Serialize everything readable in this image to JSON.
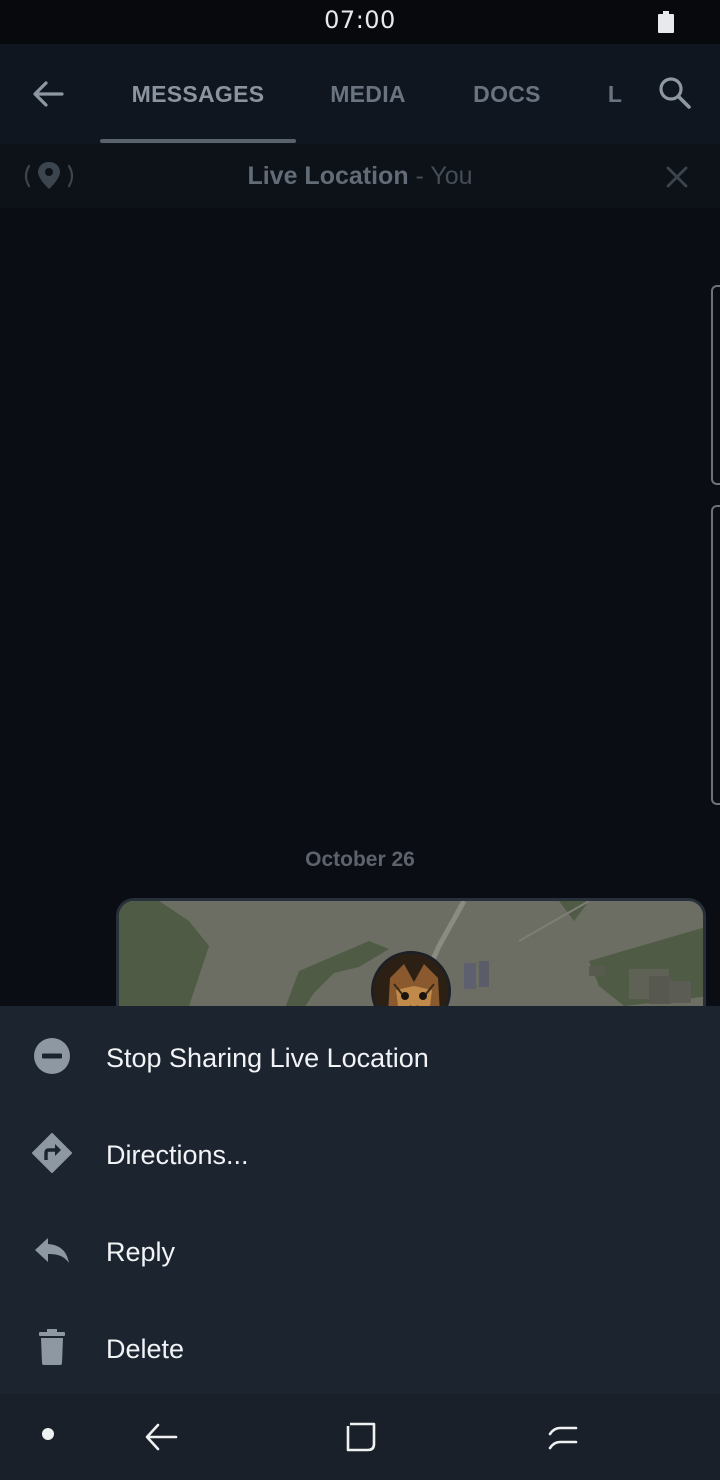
{
  "status_bar": {
    "time": "07:00"
  },
  "toolbar": {
    "tabs": [
      {
        "label": "MESSAGES",
        "active": true
      },
      {
        "label": "MEDIA",
        "active": false
      },
      {
        "label": "DOCS",
        "active": false
      },
      {
        "label": "L",
        "active": false
      }
    ]
  },
  "live_location": {
    "title": "Live Location",
    "subtitle": " - You"
  },
  "chat": {
    "date_divider": "October 26"
  },
  "menu": {
    "items": [
      {
        "label": "Stop Sharing Live Location",
        "icon": "stop-sharing-icon"
      },
      {
        "label": "Directions...",
        "icon": "directions-icon"
      },
      {
        "label": "Reply",
        "icon": "reply-icon"
      },
      {
        "label": "Delete",
        "icon": "trash-icon"
      }
    ]
  },
  "colors": {
    "background": "#0a0d13",
    "toolbar": "#101620",
    "sheet": "#1c2430",
    "menu_text": "#f1f3f5",
    "icon_gray": "#8e98a3"
  }
}
